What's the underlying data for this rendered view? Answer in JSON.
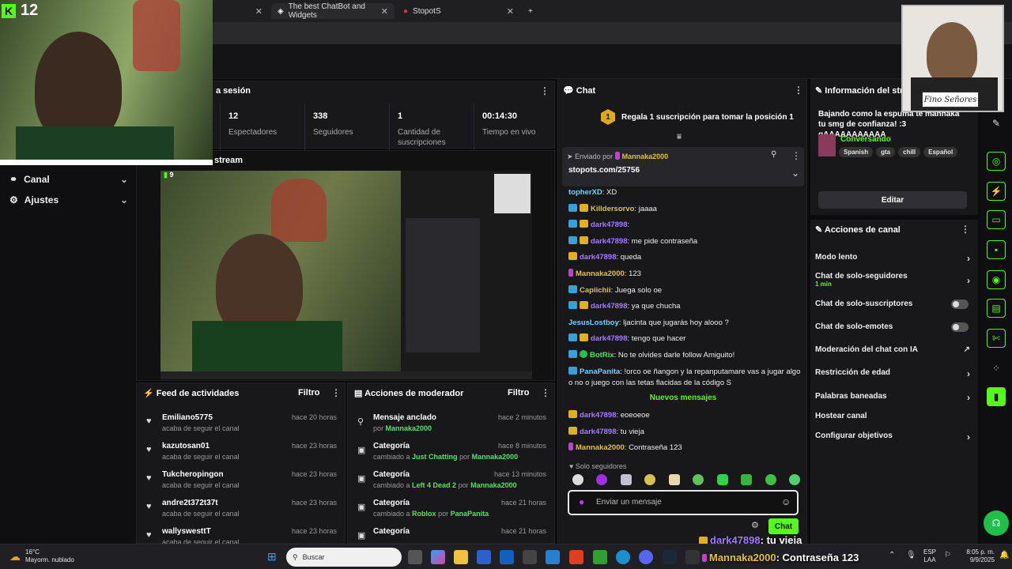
{
  "browser": {
    "tabs": [
      {
        "label": "The best ChatBot and Widgets"
      },
      {
        "label": "StopotS"
      }
    ]
  },
  "overlay_cam": {
    "viewer_count": "12",
    "caption_tag": "Fino Señores"
  },
  "sidebar": {
    "items": [
      {
        "label": "Canal"
      },
      {
        "label": "Ajustes"
      }
    ]
  },
  "session": {
    "title_fragment": "a sesión",
    "stats": [
      {
        "value": "12",
        "label": "Espectadores"
      },
      {
        "value": "338",
        "label": "Seguidores"
      },
      {
        "value": "1",
        "label": "Cantidad de suscripciones"
      },
      {
        "value": "00:14:30",
        "label": "Tiempo en vivo"
      }
    ]
  },
  "stream_section": {
    "title_fragment": "stream",
    "viewer_badge": "9"
  },
  "feed": {
    "title": "Feed de actividades",
    "filter": "Filtro",
    "rows": [
      {
        "name": "Emiliano5775",
        "action": "acaba de seguir el canal",
        "time": "hace 20 horas"
      },
      {
        "name": "kazutosan01",
        "action": "acaba de seguir el canal",
        "time": "hace 23 horas"
      },
      {
        "name": "Tukcheropingon",
        "action": "acaba de seguir el canal",
        "time": "hace 23 horas"
      },
      {
        "name": "andre2t372t37t",
        "action": "acaba de seguir el canal",
        "time": "hace 23 horas"
      },
      {
        "name": "wallyswesttT",
        "action": "acaba de seguir el canal",
        "time": "hace 23 horas"
      }
    ]
  },
  "modactions": {
    "title": "Acciones de moderador",
    "filter": "Filtro",
    "rows": [
      {
        "title": "Mensaje anclado",
        "detail_prefix": "por",
        "detail_value": "",
        "detail_user": "Mannaka2000",
        "time": "hace 2 minutos"
      },
      {
        "title": "Categoría",
        "detail_prefix": "cambiado a",
        "detail_value": "Just Chatting",
        "detail_mid": "por",
        "detail_user": "Mannaka2000",
        "time": "hace 8 minutos"
      },
      {
        "title": "Categoría",
        "detail_prefix": "cambiado a",
        "detail_value": "Left 4 Dead 2",
        "detail_mid": "por",
        "detail_user": "Mannaka2000",
        "time": "hace 13 minutos"
      },
      {
        "title": "Categoría",
        "detail_prefix": "cambiado a",
        "detail_value": "Roblox",
        "detail_mid": "por",
        "detail_user": "PanaPanita",
        "time": "hace 21 horas"
      },
      {
        "title": "Categoría",
        "detail_prefix": "",
        "detail_value": "",
        "detail_user": "",
        "time": "hace 21 horas"
      }
    ]
  },
  "chat": {
    "title": "Chat",
    "promo_number": "1",
    "promo_text": "Regala 1 suscripción para tomar la posición 1",
    "pinned": {
      "sent_by": "Enviado por",
      "user": "Mannaka2000",
      "text": "stopots.com/25756"
    },
    "messages": [
      {
        "user": "topherXD",
        "text": ": XD",
        "color": "cyan",
        "badges": []
      },
      {
        "user": "Killdersorvo",
        "text": ": jaaaa",
        "color": "yellow",
        "badges": [
          "blue",
          "gold"
        ]
      },
      {
        "user": "dark47898",
        "text": ":",
        "color": "purple",
        "badges": [
          "blue",
          "gold"
        ]
      },
      {
        "user": "dark47898",
        "text": ": me pide contraseña",
        "color": "purple",
        "badges": [
          "blue",
          "gold"
        ]
      },
      {
        "user": "dark47898",
        "text": ": queda",
        "color": "purple",
        "badges": [
          "gold"
        ]
      },
      {
        "user": "Mannaka2000",
        "text": ": 123",
        "color": "gold",
        "badges": [
          "pink"
        ]
      },
      {
        "user": "Capiichii",
        "text": ": Juega solo oe",
        "color": "yellow",
        "badges": [
          "blue"
        ]
      },
      {
        "user": "dark47898",
        "text": ": ya que chucha",
        "color": "purple",
        "badges": [
          "blue",
          "gold"
        ]
      },
      {
        "user": "JesusLostboy",
        "text": ": ljacinta que jugarás hoy alooo ?",
        "color": "cyan",
        "badges": []
      },
      {
        "user": "dark47898",
        "text": ": tengo que hacer",
        "color": "purple",
        "badges": [
          "blue",
          "gold"
        ]
      },
      {
        "user": "BotRix",
        "text": ": No te olvides darle follow Amiguito!",
        "color": "green",
        "badges": [
          "blue",
          "green"
        ]
      },
      {
        "user": "PanaPanita",
        "text": ": !orco oe ñangon y la repanputamare vas a jugar algo o no o juego con las tetas flacidas de la código S",
        "color": "cyan",
        "badges": [
          "blue"
        ]
      }
    ],
    "new_messages_label": "Nuevos mensajes",
    "new_messages": [
      {
        "user": "dark47898",
        "text": ": eoeoeoe",
        "color": "purple",
        "badges": [
          "gold"
        ]
      },
      {
        "user": "dark47898",
        "text": ": tu vieja",
        "color": "purple",
        "badges": [
          "gold"
        ]
      },
      {
        "user": "Mannaka2000",
        "text": ": Contraseña 123",
        "color": "gold",
        "badges": [
          "pink"
        ]
      }
    ],
    "followers_only": "Solo seguidores",
    "input_placeholder": "Enviar un mensaje",
    "send_label": "Chat"
  },
  "info": {
    "title": "Información del strea",
    "stream_title": "Bajando como la espuma te mannaka tu smg de confianza! :3 gAAAAAAAAAAA",
    "category": "Conversando",
    "tags": [
      "Spanish",
      "gta",
      "chill",
      "Español"
    ],
    "edit_label": "Editar"
  },
  "actions": {
    "title": "Acciones de canal",
    "rows": [
      {
        "label": "Modo lento",
        "kind": "chevron"
      },
      {
        "label": "Chat de solo-seguidores",
        "sub": "1 min",
        "kind": "chevron"
      },
      {
        "label": "Chat de solo-suscriptores",
        "kind": "toggle"
      },
      {
        "label": "Chat de solo-emotes",
        "kind": "toggle"
      },
      {
        "label": "Moderación del chat con IA",
        "kind": "external"
      },
      {
        "label": "Restricción de edad",
        "kind": "chevron"
      },
      {
        "label": "Palabras baneadas",
        "kind": "chevron"
      },
      {
        "label": "Hostear canal",
        "kind": "none"
      },
      {
        "label": "Configurar objetivos",
        "kind": "chevron"
      }
    ]
  },
  "overlay_alert": {
    "line1_user": "dark47898",
    "line1_text": ": tu vieja",
    "line2_user": "Mannaka2000",
    "line2_text": ": Contraseña 123"
  },
  "taskbar": {
    "weather_temp": "16°C",
    "weather_desc": "Mayorm. nublado",
    "search_placeholder": "Buscar",
    "lang_top": "ESP",
    "lang_bottom": "LAA",
    "time": "8:05 p. m.",
    "date": "9/9/2025"
  },
  "colors": {
    "accent": "#53fc18",
    "panel": "#18181b",
    "bg": "#0b0b0d"
  }
}
